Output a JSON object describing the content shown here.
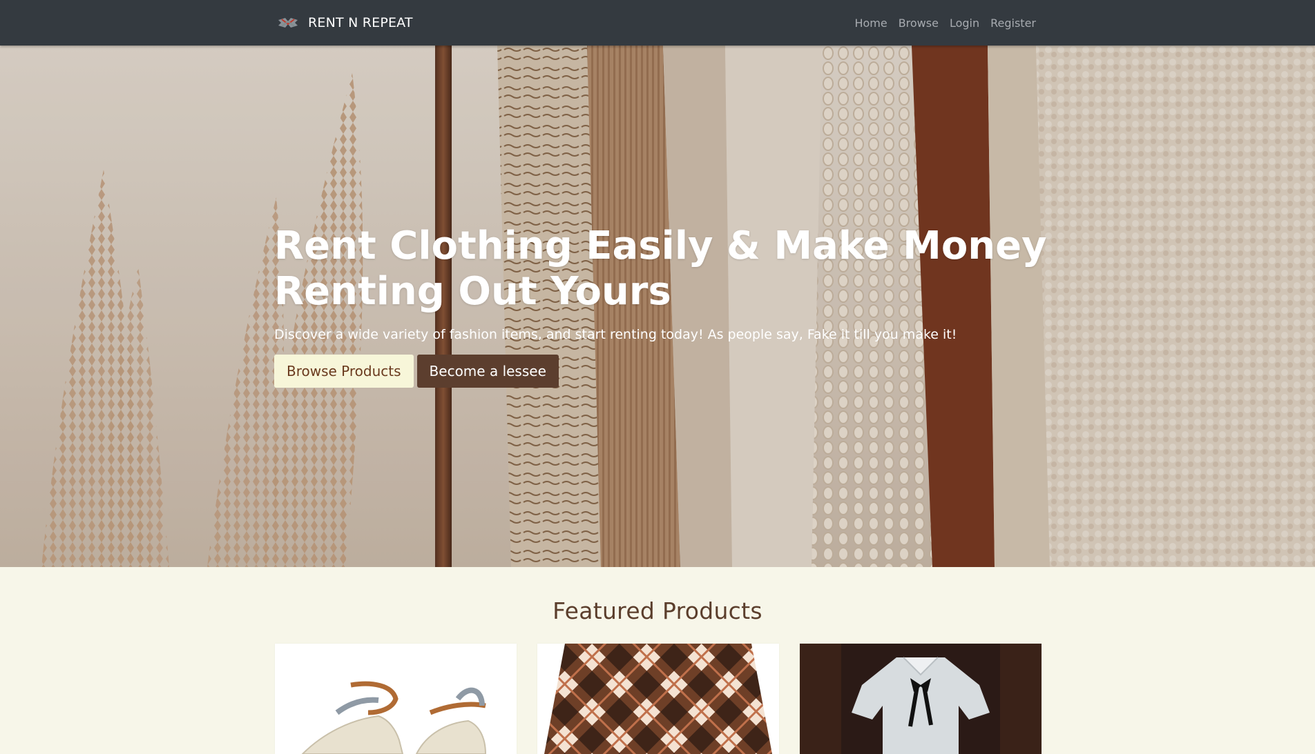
{
  "nav": {
    "brand": "RENT N REPEAT",
    "logo_icon": "rent-n-repeat-logo",
    "links": [
      "Home",
      "Browse",
      "Login",
      "Register"
    ]
  },
  "hero": {
    "title": "Rent Clothing Easily & Make Money Renting Out Yours",
    "subtitle": "Discover a wide variety of fashion items, and start renting today! As people say, Fake it till you make it!",
    "browse_button": "Browse Products",
    "lessee_button": "Become a lessee"
  },
  "featured": {
    "title": "Featured Products",
    "products": [
      {
        "image": "beige-strap-flats-image"
      },
      {
        "image": "brown-plaid-skirt-image"
      },
      {
        "image": "tweed-dress-with-bow-image"
      }
    ]
  },
  "colors": {
    "navbar": "#343a40",
    "page_background": "#f7f6e9",
    "button_light": "#f7f6d9",
    "button_dark": "#5c3e2e",
    "heading": "#5b3e2c"
  }
}
